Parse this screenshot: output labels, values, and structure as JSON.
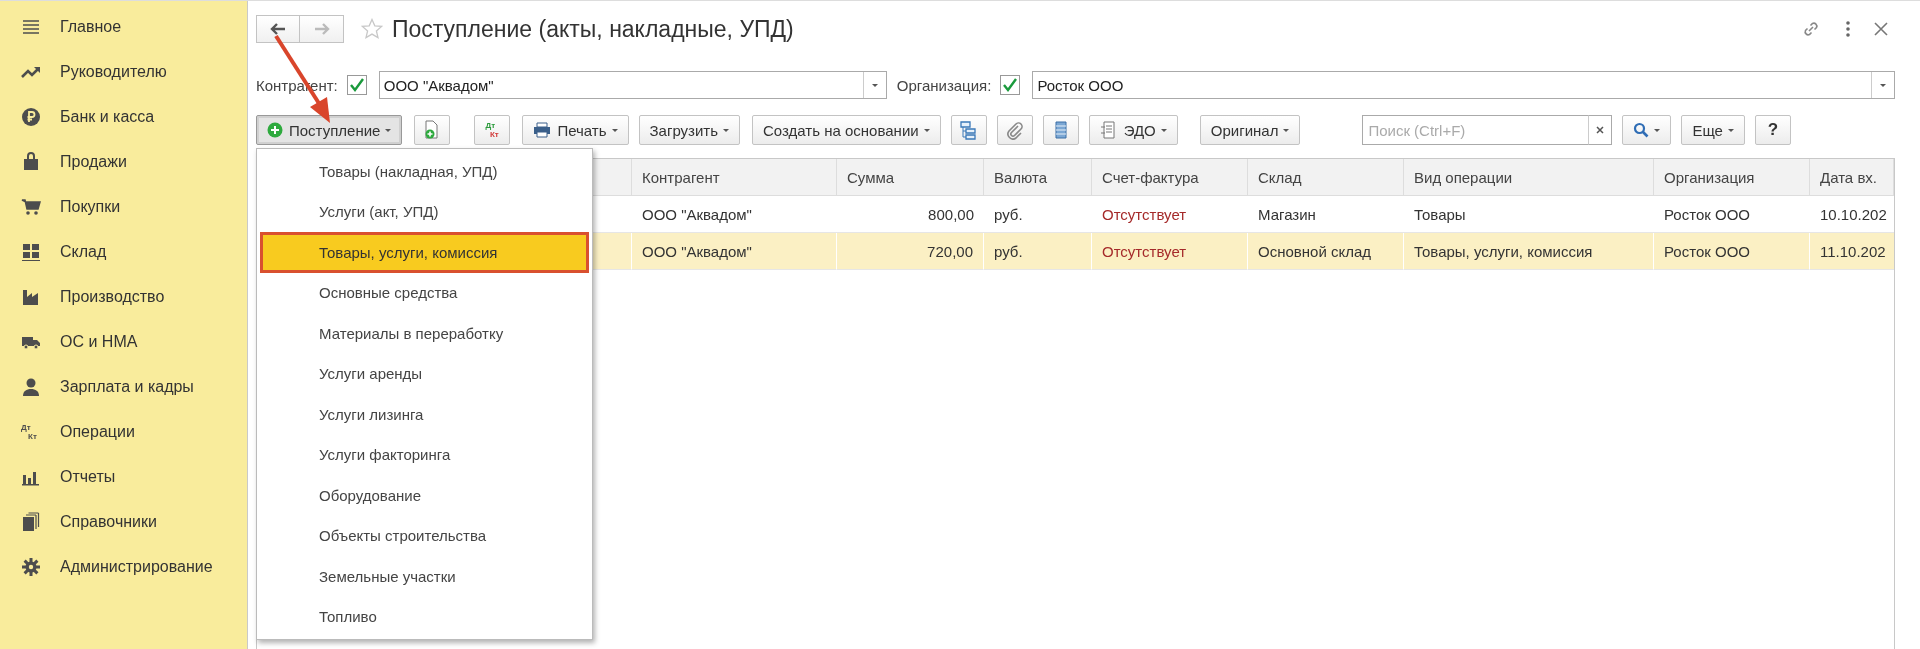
{
  "sidebar": {
    "items": [
      {
        "label": "Главное"
      },
      {
        "label": "Руководителю"
      },
      {
        "label": "Банк и касса"
      },
      {
        "label": "Продажи"
      },
      {
        "label": "Покупки"
      },
      {
        "label": "Склад"
      },
      {
        "label": "Производство"
      },
      {
        "label": "ОС и НМА"
      },
      {
        "label": "Зарплата и кадры"
      },
      {
        "label": "Операции",
        "icon_text": [
          "Дт",
          "Кт"
        ]
      },
      {
        "label": "Отчеты"
      },
      {
        "label": "Справочники"
      },
      {
        "label": "Администрирование"
      }
    ]
  },
  "window": {
    "title": "Поступление (акты, накладные, УПД)"
  },
  "filters": [
    {
      "label": "Контрагент:",
      "checked": true,
      "value": "ООО \"Аквадом\""
    },
    {
      "label": "Организация:",
      "checked": true,
      "value": "Росток ООО"
    }
  ],
  "toolbar": [
    {
      "kind": "menu",
      "label": "Поступление",
      "pressed": true
    },
    {
      "kind": "icon"
    },
    {
      "kind": "letters",
      "lines": [
        "Дт",
        "Кт"
      ]
    },
    {
      "kind": "menu",
      "label": "Печать",
      "pressed": false
    },
    {
      "kind": "menu",
      "label": "Загрузить",
      "pressed": false
    },
    {
      "kind": "menu",
      "label": "Создать на основании",
      "pressed": false
    },
    {
      "kind": "icon"
    },
    {
      "kind": "icon"
    },
    {
      "kind": "icon"
    },
    {
      "kind": "menu",
      "label": "ЭДО",
      "pressed": false
    },
    {
      "kind": "menu",
      "label": "Оригинал",
      "pressed": false
    },
    {
      "kind": "search",
      "placeholder": "Поиск (Ctrl+F)"
    },
    {
      "kind": "icon-menu"
    },
    {
      "kind": "menu",
      "label": "Еще",
      "pressed": false
    },
    {
      "kind": "plain",
      "label": "?"
    }
  ],
  "table": {
    "columns": [
      "",
      "Контрагент",
      "Сумма",
      "Валюта",
      "Счет-фактура",
      "Склад",
      "Вид операции",
      "Организация",
      "Дата вх."
    ],
    "rows": [
      {
        "selected": false,
        "cells": [
          "",
          "ООО \"Аквадом\"",
          "800,00",
          "руб.",
          "Отсутствует",
          "Магазин",
          "Товары",
          "Росток ООО",
          "10.10.202"
        ]
      },
      {
        "selected": true,
        "cells": [
          "",
          "ООО \"Аквадом\"",
          "720,00",
          "руб.",
          "Отсутствует",
          "Основной склад",
          "Товары, услуги, комиссия",
          "Росток ООО",
          "11.10.202"
        ]
      }
    ]
  },
  "menu": {
    "items": [
      {
        "label": "Товары (накладная, УПД)",
        "selected": false
      },
      {
        "label": "Услуги (акт, УПД)",
        "selected": false
      },
      {
        "label": "Товары, услуги, комиссия",
        "selected": true
      },
      {
        "label": "Основные средства",
        "selected": false
      },
      {
        "label": "Материалы в переработку",
        "selected": false
      },
      {
        "label": "Услуги аренды",
        "selected": false
      },
      {
        "label": "Услуги лизинга",
        "selected": false
      },
      {
        "label": "Услуги факторинга",
        "selected": false
      },
      {
        "label": "Оборудование",
        "selected": false
      },
      {
        "label": "Объекты строительства",
        "selected": false
      },
      {
        "label": "Земельные участки",
        "selected": false
      },
      {
        "label": "Топливо",
        "selected": false
      }
    ]
  }
}
